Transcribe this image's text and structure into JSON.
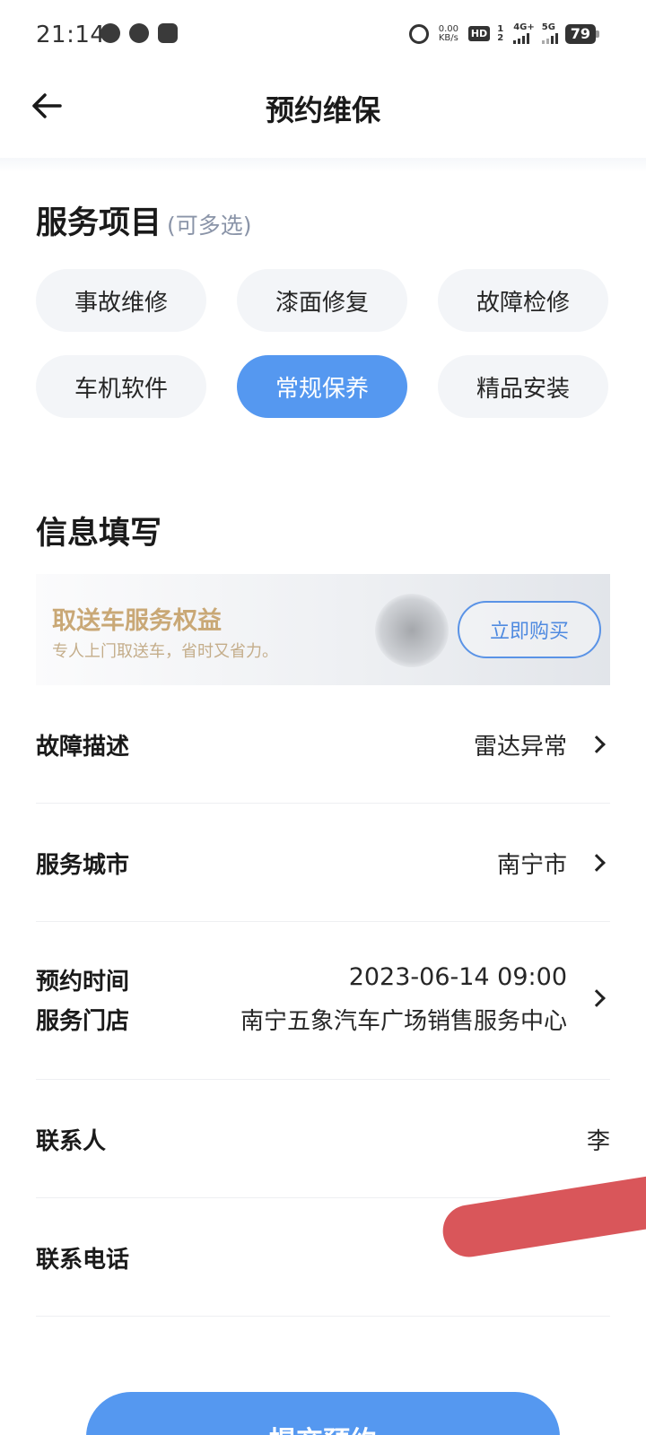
{
  "status_bar": {
    "time": "21:14",
    "net_speed_value": "0.00",
    "net_speed_unit": "KB/s",
    "hd_label": "HD",
    "sim_index": "1 2",
    "network_4g": "4G+",
    "network_5g": "5G",
    "battery": "79"
  },
  "nav": {
    "title": "预约维保"
  },
  "service_section": {
    "title": "服务项目",
    "hint": "(可多选)",
    "items": [
      {
        "label": "事故维修",
        "selected": false
      },
      {
        "label": "漆面修复",
        "selected": false
      },
      {
        "label": "故障检修",
        "selected": false
      },
      {
        "label": "车机软件",
        "selected": false
      },
      {
        "label": "常规保养",
        "selected": true
      },
      {
        "label": "精品安装",
        "selected": false
      }
    ]
  },
  "info_section": {
    "title": "信息填写"
  },
  "promo": {
    "title": "取送车服务权益",
    "subtitle": "专人上门取送车，省时又省力。",
    "button": "立即购买"
  },
  "form": {
    "fault": {
      "label": "故障描述",
      "value": "雷达异常"
    },
    "city": {
      "label": "服务城市",
      "value": "南宁市"
    },
    "appointment_time": {
      "label": "预约时间",
      "value": "2023-06-14 09:00"
    },
    "store": {
      "label": "服务门店",
      "value": "南宁五象汽车广场销售服务中心"
    },
    "contact": {
      "label": "联系人",
      "value": "李"
    },
    "phone": {
      "label": "联系电话",
      "value": ""
    }
  },
  "submit": {
    "label": "提交预约"
  },
  "colors": {
    "accent": "#5598f0",
    "chip_bg": "#f3f5f8",
    "promo_gold": "#c9a876",
    "promo_button": "#4f8ae0"
  }
}
